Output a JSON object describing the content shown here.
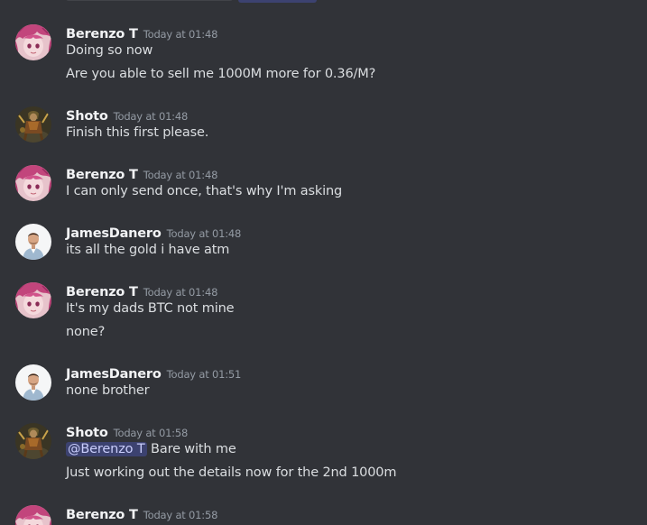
{
  "messages": [
    {
      "author": "Berenzo T",
      "timestamp": "Today at 01:48",
      "avatar": "pink-hair-anime-avatar",
      "lines": [
        "Doing so now",
        "Are you able to sell me 1000M more for 0.36/M?"
      ]
    },
    {
      "author": "Shoto",
      "timestamp": "Today at 01:48",
      "avatar": "warrior-character-avatar",
      "lines": [
        "Finish this first please."
      ]
    },
    {
      "author": "Berenzo T",
      "timestamp": "Today at 01:48",
      "avatar": "pink-hair-anime-avatar",
      "lines": [
        "I can only send once, that's why I'm asking"
      ]
    },
    {
      "author": "JamesDanero",
      "timestamp": "Today at 01:48",
      "avatar": "man-portrait-avatar",
      "lines": [
        "its all the gold i have atm"
      ]
    },
    {
      "author": "Berenzo T",
      "timestamp": "Today at 01:48",
      "avatar": "pink-hair-anime-avatar",
      "lines": [
        "It's my dads BTC not mine",
        "none?"
      ]
    },
    {
      "author": "JamesDanero",
      "timestamp": "Today at 01:51",
      "avatar": "man-portrait-avatar",
      "lines": [
        "none brother"
      ]
    },
    {
      "author": "Shoto",
      "timestamp": "Today at 01:58",
      "avatar": "warrior-character-avatar",
      "mention": "@Berenzo T",
      "mention_rest": " Bare with me",
      "lines": [
        "Just working out the details now for the 2nd 1000m"
      ]
    },
    {
      "author": "Berenzo T",
      "timestamp": "Today at 01:58",
      "avatar": "pink-hair-anime-avatar",
      "lines": []
    }
  ],
  "colors": {
    "background": "#313338",
    "username": "#f2f3f5",
    "timestamp": "#949ba4",
    "text": "#dbdee1",
    "mention_bg": "#3c4270",
    "mention_text": "#c9cdfb"
  }
}
